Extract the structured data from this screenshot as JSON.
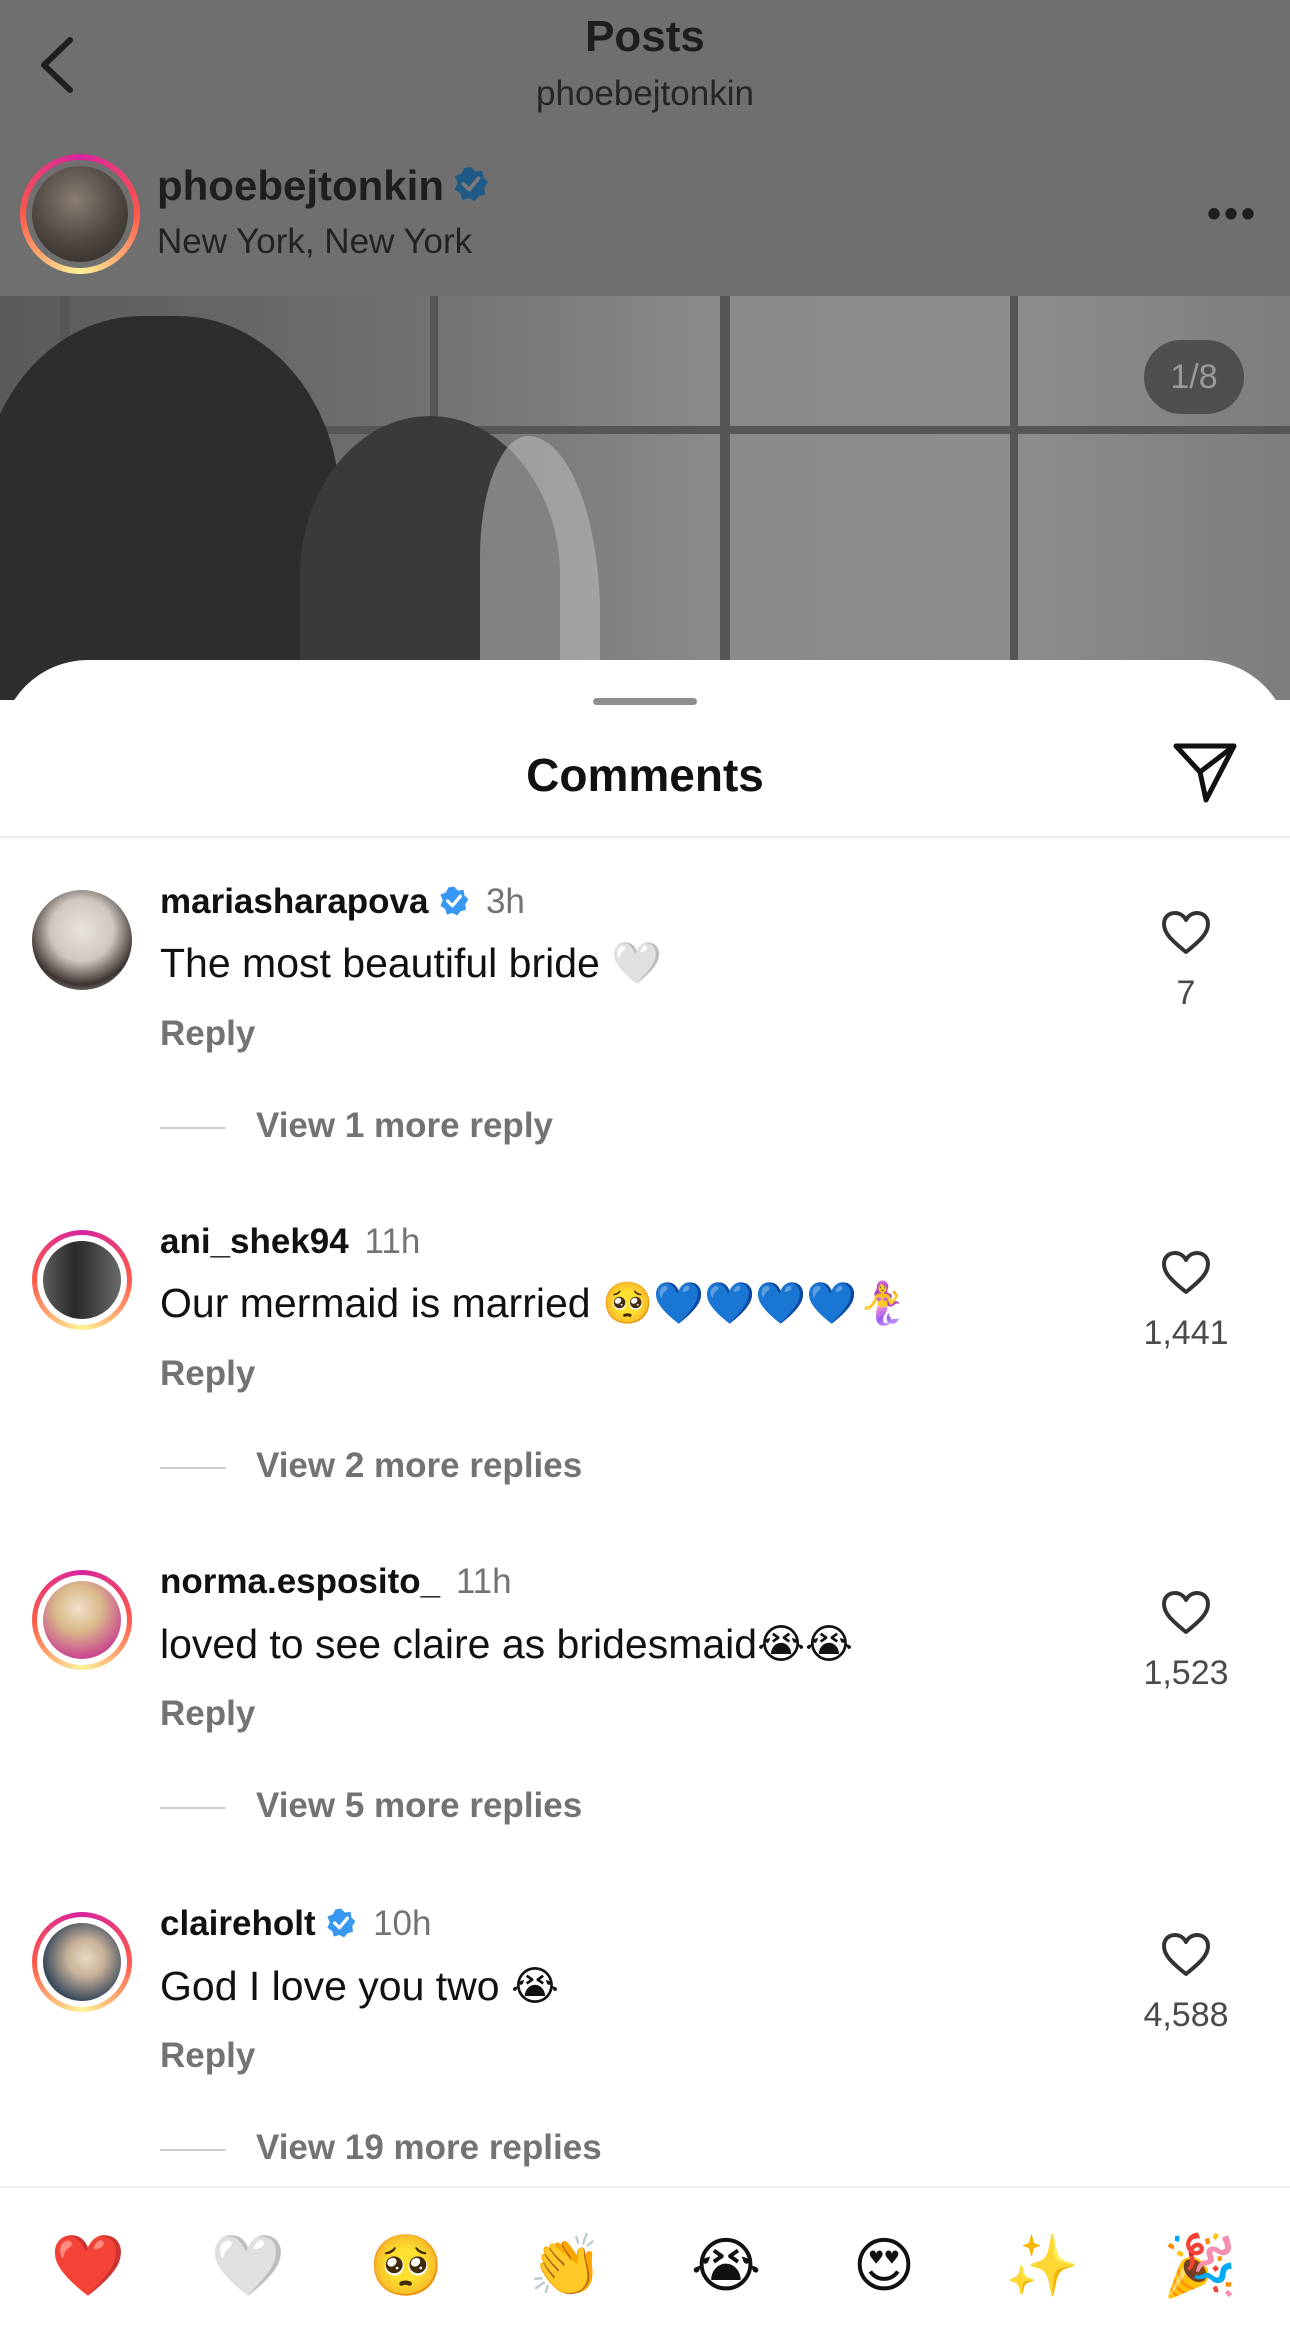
{
  "header": {
    "title": "Posts",
    "subtitle": "phoebejtonkin"
  },
  "post": {
    "username": "phoebejtonkin",
    "location": "New York, New York",
    "image_counter": "1/8"
  },
  "sheet": {
    "title": "Comments"
  },
  "comments": [
    {
      "username": "mariasharapova",
      "verified": true,
      "time": "3h",
      "text": "The most beautiful bride 🤍",
      "reply_label": "Reply",
      "likes": "7",
      "view_more": "View 1 more reply"
    },
    {
      "username": "ani_shek94",
      "verified": false,
      "time": "11h",
      "text": "Our mermaid is married 🥺💙💙💙💙🧜‍♀️",
      "reply_label": "Reply",
      "likes": "1,441",
      "view_more": "View 2 more replies"
    },
    {
      "username": "norma.esposito_",
      "verified": false,
      "time": "11h",
      "text": "loved to see claire as bridesmaid😭😭",
      "reply_label": "Reply",
      "likes": "1,523",
      "view_more": "View 5 more replies"
    },
    {
      "username": "claireholt",
      "verified": true,
      "time": "10h",
      "text": "God I love you two 😭",
      "reply_label": "Reply",
      "likes": "4,588",
      "view_more": "View 19 more replies"
    }
  ],
  "emoji_bar": [
    "❤️",
    "🤍",
    "🥺",
    "👏",
    "😭",
    "😍",
    "✨",
    "🎉"
  ],
  "colors": {
    "verified_blue": "#3897f0",
    "secondary_text": "#737373",
    "story_ring_start": "#d6249f",
    "story_ring_end": "#fdf497"
  }
}
